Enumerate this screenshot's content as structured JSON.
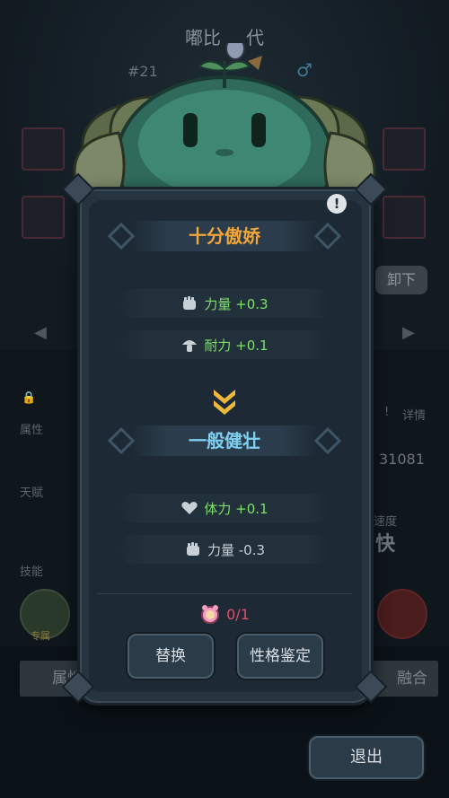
{
  "background": {
    "pet_name_partial": "嘟比",
    "pet_name_suffix": "代",
    "pet_number": "#21",
    "gender_symbol": "♂",
    "unload_button": "卸下",
    "labels": {
      "attribute": "属性",
      "talent": "天赋",
      "skill": "技能",
      "speed_label": "速度",
      "details": "详情"
    },
    "values": {
      "power_total": "31081",
      "speed_value": "快"
    },
    "tabs": {
      "left": "属性",
      "right": "融合"
    },
    "skill_badge": "专属"
  },
  "modal": {
    "current_trait": {
      "name": "十分傲娇",
      "stats": [
        {
          "icon": "fist-icon",
          "text": "力量 +0.3",
          "trend": "up"
        },
        {
          "icon": "mushroom-icon",
          "text": "耐力 +0.1",
          "trend": "up"
        }
      ]
    },
    "new_trait": {
      "name": "一般健壮",
      "stats": [
        {
          "icon": "heart-icon",
          "text": "体力 +0.1",
          "trend": "up"
        },
        {
          "icon": "fist-icon",
          "text": "力量 -0.3",
          "trend": "down"
        }
      ]
    },
    "cost": {
      "icon": "pet-food-icon",
      "text": "0/1"
    },
    "buttons": {
      "replace": "替换",
      "identify": "性格鉴定"
    }
  },
  "exit_button": "退出",
  "colors": {
    "current_title": "#f3a63a",
    "new_title": "#7fd0f0",
    "stat_up": "#7ee06a",
    "cost_red": "#e0506a"
  }
}
